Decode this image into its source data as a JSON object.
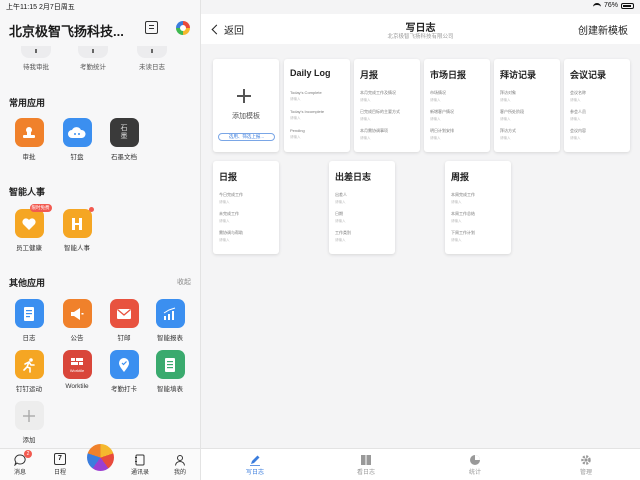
{
  "status_bar": {
    "time_date": "上午11:15 2月7日周五",
    "battery": "76%"
  },
  "org": {
    "title": "北京极智飞扬科技..."
  },
  "shortcuts": [
    {
      "label": "待我审批"
    },
    {
      "label": "考勤统计"
    },
    {
      "label": "未读日志"
    }
  ],
  "sections": {
    "common": {
      "title": "常用应用"
    },
    "smart_hr": {
      "title": "智能人事"
    },
    "other": {
      "title": "其他应用",
      "action": "收起"
    }
  },
  "common_apps": [
    {
      "label": "审批",
      "color": "#f0812b",
      "icon": "stamp-icon"
    },
    {
      "label": "钉盘",
      "color": "#3b8ff0",
      "icon": "cloud-icon"
    },
    {
      "label": "石墨文档",
      "color": "#3a3a3a",
      "icon": "shimo-icon",
      "glyph": "石墨"
    }
  ],
  "smart_hr_apps": [
    {
      "label": "员工健康",
      "color": "#f5a623",
      "icon": "heart-icon",
      "badge": "限时免费"
    },
    {
      "label": "智能人事",
      "color": "#f5a623",
      "icon": "hr-icon"
    }
  ],
  "other_apps": [
    {
      "label": "日志",
      "color": "#3b8ff0",
      "icon": "log-icon"
    },
    {
      "label": "公告",
      "color": "#f0812b",
      "icon": "megaphone-icon"
    },
    {
      "label": "钉邮",
      "color": "#e8523f",
      "icon": "mail-icon"
    },
    {
      "label": "智能报表",
      "color": "#3b8ff0",
      "icon": "chart-icon"
    },
    {
      "label": "钉钉运动",
      "color": "#f5a623",
      "icon": "run-icon"
    },
    {
      "label": "Worktile",
      "color": "#d9463a",
      "icon": "worktile-icon",
      "glyph": "Worktile"
    },
    {
      "label": "考勤打卡",
      "color": "#3b8ff0",
      "icon": "location-icon"
    },
    {
      "label": "智能填表",
      "color": "#3aaa6e",
      "icon": "form-icon"
    },
    {
      "label": "添加",
      "color": "#ededed",
      "icon": "plus-icon"
    }
  ],
  "bottom_nav": [
    {
      "label": "消息",
      "icon": "message-icon",
      "badge": "2"
    },
    {
      "label": "日程",
      "icon": "calendar-icon",
      "glyph": "7"
    },
    {
      "label": "",
      "icon": "ding-center-icon"
    },
    {
      "label": "通讯录",
      "icon": "contacts-icon"
    },
    {
      "label": "我的",
      "icon": "profile-icon"
    }
  ],
  "header": {
    "back": "返回",
    "title": "写日志",
    "subtitle": "北京极智飞扬科技有限公司",
    "action": "创建新模板"
  },
  "add_template": {
    "label": "添加模板",
    "selector": "选用、筛选上报..."
  },
  "templates_row1": [
    {
      "title": "Daily Log",
      "fields": [
        {
          "label": "Today's Complete",
          "hint": "请输入"
        },
        {
          "label": "Today's Incomplete",
          "hint": "请输入"
        },
        {
          "label": "Pending",
          "hint": "请输入"
        }
      ]
    },
    {
      "title": "月报",
      "fields": [
        {
          "label": "本月完成工作及情况",
          "hint": "请输入"
        },
        {
          "label": "已完成目标的主要方式",
          "hint": "请输入"
        },
        {
          "label": "本月需协调事项",
          "hint": "请输入"
        }
      ]
    },
    {
      "title": "市场日报",
      "fields": [
        {
          "label": "市场情况",
          "hint": "请输入"
        },
        {
          "label": "新增客户情况",
          "hint": "请输入"
        },
        {
          "label": "明日计划安排",
          "hint": "请输入"
        }
      ]
    },
    {
      "title": "拜访记录",
      "fields": [
        {
          "label": "拜访对象",
          "hint": "请输入"
        },
        {
          "label": "客户所处阶段",
          "hint": "请输入"
        },
        {
          "label": "拜访方式",
          "hint": "请输入"
        }
      ]
    },
    {
      "title": "会议记录",
      "fields": [
        {
          "label": "会议名称",
          "hint": "请输入"
        },
        {
          "label": "参会人员",
          "hint": "请输入"
        },
        {
          "label": "会议内容",
          "hint": "请输入"
        }
      ]
    }
  ],
  "templates_row2": [
    {
      "title": "日报",
      "fields": [
        {
          "label": "今日完成工作",
          "hint": "请输入"
        },
        {
          "label": "未完成工作",
          "hint": "请输入"
        },
        {
          "label": "需协调与帮助",
          "hint": "请输入"
        }
      ]
    },
    {
      "title": "出差日志",
      "fields": [
        {
          "label": "出差人",
          "hint": "请输入"
        },
        {
          "label": "日期",
          "hint": "请输入"
        },
        {
          "label": "工作类别",
          "hint": "请输入"
        }
      ]
    },
    {
      "title": "周报",
      "fields": [
        {
          "label": "本周完成工作",
          "hint": "请输入"
        },
        {
          "label": "本周工作总结",
          "hint": "请输入"
        },
        {
          "label": "下周工作计划",
          "hint": "请输入"
        }
      ]
    }
  ],
  "tabbar": [
    {
      "label": "写日志",
      "icon": "pen-icon",
      "active": true
    },
    {
      "label": "看日志",
      "icon": "book-icon"
    },
    {
      "label": "统计",
      "icon": "pie-icon"
    },
    {
      "label": "管理",
      "icon": "gear-icon"
    }
  ],
  "colors": {
    "accent": "#3b7ddd",
    "badge": "#f25a50"
  }
}
